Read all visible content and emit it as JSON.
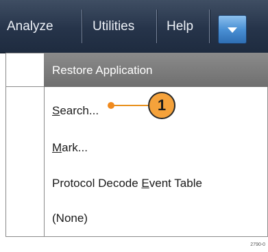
{
  "menubar": {
    "items": [
      {
        "label": "Analyze"
      },
      {
        "label": "Utilities"
      },
      {
        "label": "Help"
      }
    ],
    "dropdown_icon": "triangle-down-icon"
  },
  "menu": {
    "items": [
      {
        "label": "Restore Application",
        "highlighted": true
      },
      {
        "pre": "",
        "u": "S",
        "post": "earch..."
      },
      {
        "pre": "",
        "u": "M",
        "post": "ark..."
      },
      {
        "pre": "Protocol Decode ",
        "u": "E",
        "post": "vent Table"
      },
      {
        "pre": "(None)",
        "u": "",
        "post": ""
      }
    ]
  },
  "callout": {
    "number": "1"
  },
  "figure_id": "2790-0"
}
